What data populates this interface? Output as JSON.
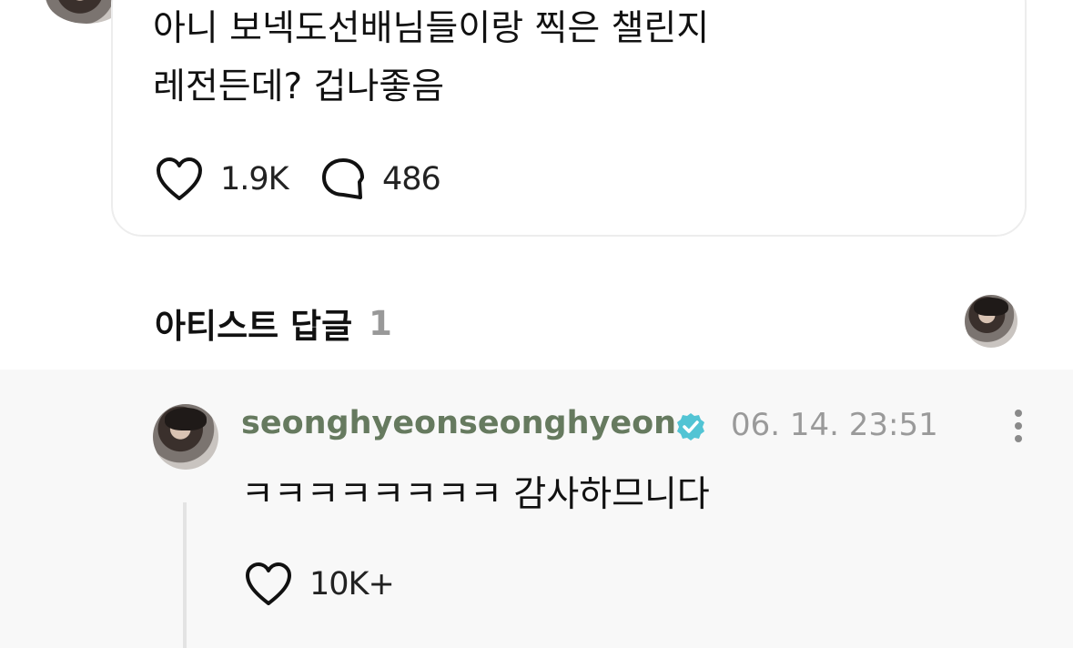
{
  "comment": {
    "text": "아니 보넥도선배님들이랑 찍은 챌린지\n레전든데? 겁나좋음",
    "likes": "1.9K",
    "replies": "486"
  },
  "artist_replies": {
    "title": "아티스트 답글",
    "count": "1"
  },
  "reply": {
    "author": "seonghyeonseonghyeon",
    "timestamp": "06. 14. 23:51",
    "text": "ㅋㅋㅋㅋㅋㅋㅋㅋ 감사하므니다",
    "likes": "10K+"
  },
  "colors": {
    "author": "#667a5f",
    "verified": "#52c4d4",
    "muted": "#999999",
    "reply_bg": "#f8f8f8"
  },
  "icons": {
    "like": "heart-outline-icon",
    "reply": "speech-bubble-icon",
    "verified": "verified-badge-icon",
    "more": "more-vertical-icon"
  }
}
